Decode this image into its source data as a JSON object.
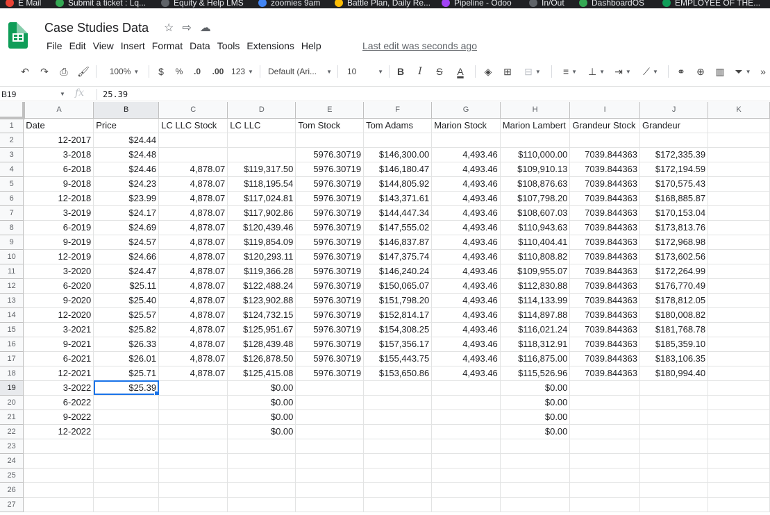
{
  "bookmarks": [
    {
      "label": "E Mail",
      "color": "#ea4335"
    },
    {
      "label": "Submit a ticket : Lq...",
      "color": "#34a853"
    },
    {
      "label": "Equity & Help LMS",
      "color": "#5f6368"
    },
    {
      "label": "zoomies 9am",
      "color": "#4285f4"
    },
    {
      "label": "Battle Plan, Daily Re...",
      "color": "#fbbc04"
    },
    {
      "label": "Pipeline - Odoo",
      "color": "#a142f4"
    },
    {
      "label": "In/Out",
      "color": "#5f6368"
    },
    {
      "label": "DashboardOS",
      "color": "#34a853"
    },
    {
      "label": "EMPLOYEE OF THE...",
      "color": "#0f9d58"
    }
  ],
  "doc": {
    "title": "Case Studies Data",
    "last_edit": "Last edit was seconds ago"
  },
  "menu": [
    "File",
    "Edit",
    "View",
    "Insert",
    "Format",
    "Data",
    "Tools",
    "Extensions",
    "Help"
  ],
  "toolbar": {
    "zoom": "100%",
    "currency": "$",
    "percent": "%",
    "dec_less": ".0",
    "dec_more": ".00",
    "number_format": "123",
    "font": "Default (Ari...",
    "font_size": "10",
    "bold": "B",
    "italic": "I",
    "strike": "S",
    "text_color": "A"
  },
  "formula_bar": {
    "cell_ref": "B19",
    "fx": "fx",
    "value": "25.39"
  },
  "columns": [
    "A",
    "B",
    "C",
    "D",
    "E",
    "F",
    "G",
    "H",
    "I",
    "J",
    "K"
  ],
  "selected_column": "B",
  "selected_row": 19,
  "rows": [
    {
      "n": "1",
      "cells": [
        "Date",
        "Price",
        "LC LLC Stock",
        "LC LLC",
        "Tom Stock",
        "Tom Adams",
        "Marion Stock",
        "Marion Lambert",
        "Grandeur Stock",
        "Grandeur",
        ""
      ]
    },
    {
      "n": "2",
      "cells": [
        "12-2017",
        "$24.44",
        "",
        "",
        "",
        "",
        "",
        "",
        "",
        "",
        ""
      ]
    },
    {
      "n": "3",
      "cells": [
        "3-2018",
        "$24.48",
        "",
        "",
        "5976.30719",
        "$146,300.00",
        "4,493.46",
        "$110,000.00",
        "7039.844363",
        "$172,335.39",
        ""
      ]
    },
    {
      "n": "4",
      "cells": [
        "6-2018",
        "$24.46",
        "4,878.07",
        "$119,317.50",
        "5976.30719",
        "$146,180.47",
        "4,493.46",
        "$109,910.13",
        "7039.844363",
        "$172,194.59",
        ""
      ]
    },
    {
      "n": "5",
      "cells": [
        "9-2018",
        "$24.23",
        "4,878.07",
        "$118,195.54",
        "5976.30719",
        "$144,805.92",
        "4,493.46",
        "$108,876.63",
        "7039.844363",
        "$170,575.43",
        ""
      ]
    },
    {
      "n": "6",
      "cells": [
        "12-2018",
        "$23.99",
        "4,878.07",
        "$117,024.81",
        "5976.30719",
        "$143,371.61",
        "4,493.46",
        "$107,798.20",
        "7039.844363",
        "$168,885.87",
        ""
      ]
    },
    {
      "n": "7",
      "cells": [
        "3-2019",
        "$24.17",
        "4,878.07",
        "$117,902.86",
        "5976.30719",
        "$144,447.34",
        "4,493.46",
        "$108,607.03",
        "7039.844363",
        "$170,153.04",
        ""
      ]
    },
    {
      "n": "8",
      "cells": [
        "6-2019",
        "$24.69",
        "4,878.07",
        "$120,439.46",
        "5976.30719",
        "$147,555.02",
        "4,493.46",
        "$110,943.63",
        "7039.844363",
        "$173,813.76",
        ""
      ]
    },
    {
      "n": "9",
      "cells": [
        "9-2019",
        "$24.57",
        "4,878.07",
        "$119,854.09",
        "5976.30719",
        "$146,837.87",
        "4,493.46",
        "$110,404.41",
        "7039.844363",
        "$172,968.98",
        ""
      ]
    },
    {
      "n": "10",
      "cells": [
        "12-2019",
        "$24.66",
        "4,878.07",
        "$120,293.11",
        "5976.30719",
        "$147,375.74",
        "4,493.46",
        "$110,808.82",
        "7039.844363",
        "$173,602.56",
        ""
      ]
    },
    {
      "n": "11",
      "cells": [
        "3-2020",
        "$24.47",
        "4,878.07",
        "$119,366.28",
        "5976.30719",
        "$146,240.24",
        "4,493.46",
        "$109,955.07",
        "7039.844363",
        "$172,264.99",
        ""
      ]
    },
    {
      "n": "12",
      "cells": [
        "6-2020",
        "$25.11",
        "4,878.07",
        "$122,488.24",
        "5976.30719",
        "$150,065.07",
        "4,493.46",
        "$112,830.88",
        "7039.844363",
        "$176,770.49",
        ""
      ]
    },
    {
      "n": "13",
      "cells": [
        "9-2020",
        "$25.40",
        "4,878.07",
        "$123,902.88",
        "5976.30719",
        "$151,798.20",
        "4,493.46",
        "$114,133.99",
        "7039.844363",
        "$178,812.05",
        ""
      ]
    },
    {
      "n": "14",
      "cells": [
        "12-2020",
        "$25.57",
        "4,878.07",
        "$124,732.15",
        "5976.30719",
        "$152,814.17",
        "4,493.46",
        "$114,897.88",
        "7039.844363",
        "$180,008.82",
        ""
      ]
    },
    {
      "n": "15",
      "cells": [
        "3-2021",
        "$25.82",
        "4,878.07",
        "$125,951.67",
        "5976.30719",
        "$154,308.25",
        "4,493.46",
        "$116,021.24",
        "7039.844363",
        "$181,768.78",
        ""
      ]
    },
    {
      "n": "16",
      "cells": [
        "9-2021",
        "$26.33",
        "4,878.07",
        "$128,439.48",
        "5976.30719",
        "$157,356.17",
        "4,493.46",
        "$118,312.91",
        "7039.844363",
        "$185,359.10",
        ""
      ]
    },
    {
      "n": "17",
      "cells": [
        "6-2021",
        "$26.01",
        "4,878.07",
        "$126,878.50",
        "5976.30719",
        "$155,443.75",
        "4,493.46",
        "$116,875.00",
        "7039.844363",
        "$183,106.35",
        ""
      ]
    },
    {
      "n": "18",
      "cells": [
        "12-2021",
        "$25.71",
        "4,878.07",
        "$125,415.08",
        "5976.30719",
        "$153,650.86",
        "4,493.46",
        "$115,526.96",
        "7039.844363",
        "$180,994.40",
        ""
      ]
    },
    {
      "n": "19",
      "cells": [
        "3-2022",
        "$25.39",
        "",
        "$0.00",
        "",
        "",
        "",
        "$0.00",
        "",
        "",
        ""
      ]
    },
    {
      "n": "20",
      "cells": [
        "6-2022",
        "",
        "",
        "$0.00",
        "",
        "",
        "",
        "$0.00",
        "",
        "",
        ""
      ]
    },
    {
      "n": "21",
      "cells": [
        "9-2022",
        "",
        "",
        "$0.00",
        "",
        "",
        "",
        "$0.00",
        "",
        "",
        ""
      ]
    },
    {
      "n": "22",
      "cells": [
        "12-2022",
        "",
        "",
        "$0.00",
        "",
        "",
        "",
        "$0.00",
        "",
        "",
        ""
      ]
    },
    {
      "n": "23",
      "cells": [
        "",
        "",
        "",
        "",
        "",
        "",
        "",
        "",
        "",
        "",
        ""
      ]
    },
    {
      "n": "24",
      "cells": [
        "",
        "",
        "",
        "",
        "",
        "",
        "",
        "",
        "",
        "",
        ""
      ]
    },
    {
      "n": "25",
      "cells": [
        "",
        "",
        "",
        "",
        "",
        "",
        "",
        "",
        "",
        "",
        ""
      ]
    },
    {
      "n": "26",
      "cells": [
        "",
        "",
        "",
        "",
        "",
        "",
        "",
        "",
        "",
        "",
        ""
      ]
    },
    {
      "n": "27",
      "cells": [
        "",
        "",
        "",
        "",
        "",
        "",
        "",
        "",
        "",
        "",
        ""
      ]
    }
  ]
}
